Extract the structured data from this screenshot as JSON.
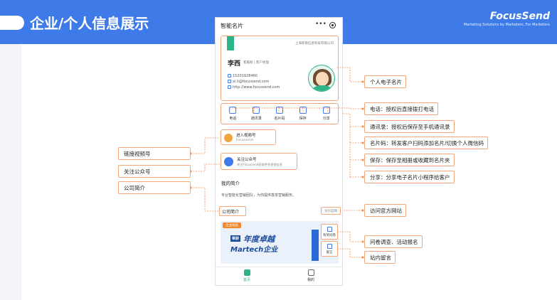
{
  "header": {
    "title": "企业/个人信息展示",
    "logo_main": "FocusSend",
    "logo_sub": "Marketing Solutions by Marketers, For Marketers",
    "bg_color": "#3e7be8"
  },
  "phone": {
    "title": "智能名片",
    "menu_glyph": "•••",
    "card": {
      "company": "上海菲斯信息科技有限公司",
      "name": "李西",
      "role": "客服部 | 客户经理",
      "phone": "15201928460",
      "email": "xi.li@focussend.com",
      "website": "http://www.focussend.com"
    },
    "actions": [
      {
        "label": "电话",
        "icon": "phone-icon"
      },
      {
        "label": "通讯录",
        "icon": "contacts-icon"
      },
      {
        "label": "名片码",
        "icon": "qrcode-icon"
      },
      {
        "label": "保存",
        "icon": "save-icon"
      },
      {
        "label": "分享",
        "icon": "share-icon"
      }
    ],
    "video": {
      "title": "进入视频号",
      "sub": "Focussend"
    },
    "official_account": {
      "title": "关注公众号",
      "sub": "关注Focussend获取更多营销信息"
    },
    "intro_head": "我的简介",
    "intro_text": "专业智能化营销团队，为你提供尊享营销服务。",
    "company_label": "公司简介",
    "visit_site": "访问官网",
    "news": {
      "tag": "企业动态",
      "badge": "荣获",
      "title": "年度卓越",
      "subtitle": "Martech企业"
    },
    "float_survey": "有奖问卷",
    "float_message": "留言",
    "tabs": [
      {
        "label": "首页",
        "active": true,
        "icon": "home-icon"
      },
      {
        "label": "我的",
        "active": false,
        "icon": "user-icon"
      }
    ]
  },
  "callouts_right": [
    "个人电子名片",
    "电话：授权后直接拨打电话",
    "通讯录：授权后保存至手机通讯录",
    "名片码：转发客户扫码添加名片/切换个人微信码",
    "保存：保存至相册或收藏到名片夹",
    "分享：分享电子名片小程序给客户",
    "访问官方网站",
    "问卷调查、活动报名",
    "站内留言"
  ],
  "callouts_left": [
    "链接视频号",
    "关注公众号",
    "公司简介"
  ],
  "colors": {
    "accent": "#3e7be8",
    "callout_border": "#f5a77b",
    "connector": "#f08a4b",
    "card_green": "#2eb38b"
  }
}
